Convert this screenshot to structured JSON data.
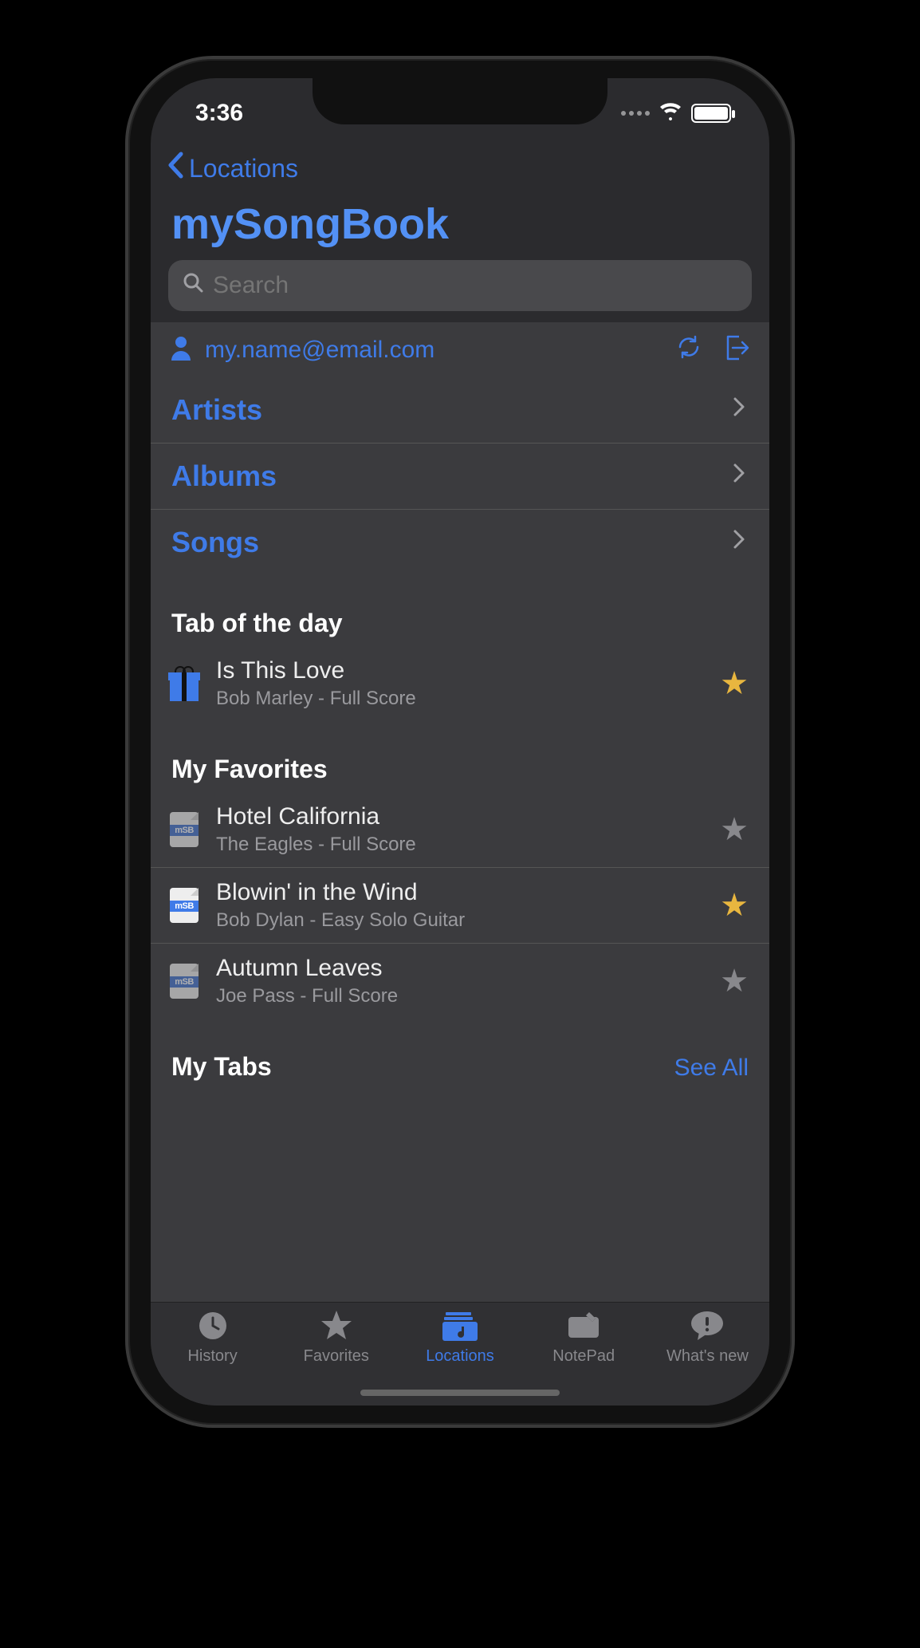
{
  "status": {
    "time": "3:36"
  },
  "nav": {
    "back_label": "Locations"
  },
  "page": {
    "title": "mySongBook"
  },
  "search": {
    "placeholder": "Search"
  },
  "account": {
    "email": "my.name@email.com"
  },
  "browse": {
    "items": [
      {
        "label": "Artists"
      },
      {
        "label": "Albums"
      },
      {
        "label": "Songs"
      }
    ]
  },
  "tab_of_day": {
    "heading": "Tab of the day",
    "item": {
      "title": "Is This Love",
      "subtitle": "Bob Marley - Full Score",
      "starred": true
    }
  },
  "favorites": {
    "heading": "My Favorites",
    "items": [
      {
        "title": "Hotel California",
        "subtitle": "The Eagles - Full Score",
        "starred": false
      },
      {
        "title": "Blowin' in the Wind",
        "subtitle": "Bob Dylan - Easy Solo Guitar",
        "starred": true
      },
      {
        "title": "Autumn Leaves",
        "subtitle": "Joe Pass - Full Score",
        "starred": false
      }
    ]
  },
  "my_tabs": {
    "heading": "My Tabs",
    "see_all_label": "See All"
  },
  "tabbar": {
    "items": [
      {
        "label": "History"
      },
      {
        "label": "Favorites"
      },
      {
        "label": "Locations"
      },
      {
        "label": "NotePad"
      },
      {
        "label": "What's new"
      }
    ],
    "active_index": 2
  },
  "icons": {
    "msb_band": "mSB"
  }
}
